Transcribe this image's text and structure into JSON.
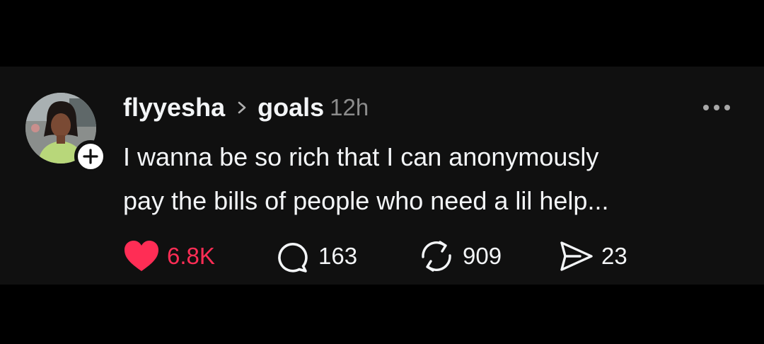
{
  "post": {
    "author": {
      "username": "flyyesha",
      "avatar_icon": "profile-photo",
      "follow_icon": "plus-icon"
    },
    "topic_separator_icon": "chevron-right-icon",
    "topic": "goals",
    "timestamp": "12h",
    "more_icon": "ellipsis-icon",
    "text_lines": [
      "I wanna be so rich that I can anonymously",
      "pay the bills of people who need a lil help..."
    ],
    "actions": {
      "like": {
        "icon": "heart-filled-icon",
        "count": "6.8K",
        "color": "#ff2d55",
        "liked": true
      },
      "reply": {
        "icon": "speech-bubble-icon",
        "count": "163"
      },
      "repost": {
        "icon": "repost-icon",
        "count": "909"
      },
      "share": {
        "icon": "send-icon",
        "count": "23"
      }
    }
  },
  "colors": {
    "page_background": "#000000",
    "post_background": "#101010",
    "text_primary": "#f3f5f7",
    "text_secondary": "#8c8c8c",
    "like_accent": "#ff2d55"
  }
}
